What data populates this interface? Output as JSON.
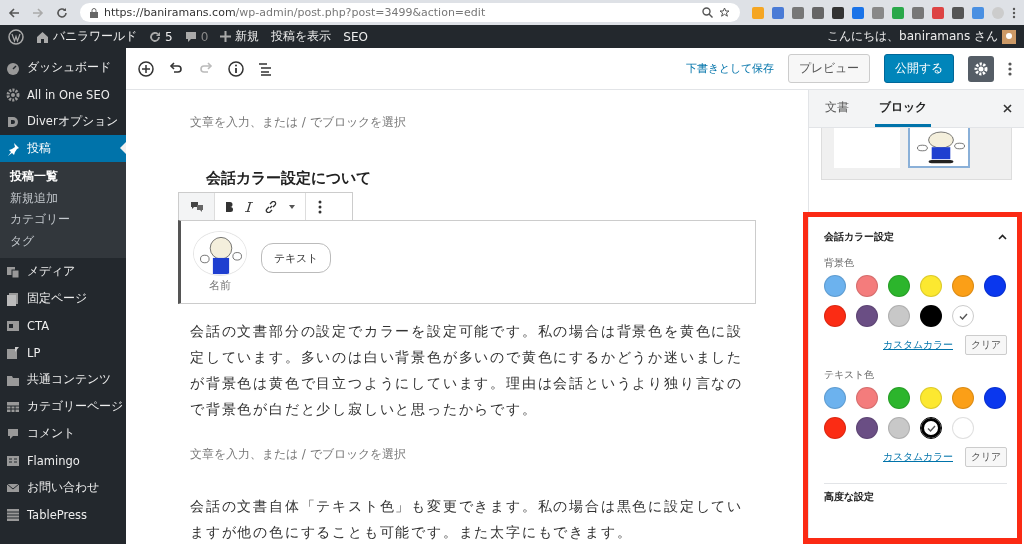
{
  "browser": {
    "url_host": "https://baniramans.com",
    "url_path": "/wp-admin/post.php?post=3499&action=edit"
  },
  "admin_bar": {
    "site": "バニラワールド",
    "updates": "5",
    "comments": "0",
    "new": "新規",
    "view": "投稿を表示",
    "seo": "SEO",
    "greeting": "こんにちは、baniramans さん"
  },
  "sidebar": {
    "items": [
      {
        "label": "ダッシュボード",
        "selected": false
      },
      {
        "label": "All in One SEO",
        "selected": false
      },
      {
        "label": "Diverオプション",
        "selected": false
      },
      {
        "label": "投稿",
        "selected": true,
        "children": [
          {
            "label": "投稿一覧",
            "selected": true
          },
          {
            "label": "新規追加",
            "selected": false
          },
          {
            "label": "カテゴリー",
            "selected": false
          },
          {
            "label": "タグ",
            "selected": false
          }
        ]
      },
      {
        "label": "メディア",
        "selected": false
      },
      {
        "label": "固定ページ",
        "selected": false
      },
      {
        "label": "CTA",
        "selected": false
      },
      {
        "label": "LP",
        "selected": false
      },
      {
        "label": "共通コンテンツ",
        "selected": false
      },
      {
        "label": "カテゴリーページ",
        "selected": false
      },
      {
        "label": "コメント",
        "selected": false
      },
      {
        "label": "Flamingo",
        "selected": false
      },
      {
        "label": "お問い合わせ",
        "selected": false
      },
      {
        "label": "TablePress",
        "selected": false
      }
    ]
  },
  "toolbar": {
    "save_draft": "下書きとして保存",
    "preview": "プレビュー",
    "publish": "公開する"
  },
  "editor": {
    "blocks": [
      {
        "kind": "placeholder",
        "text": "文章を入力、または / でブロックを選択"
      },
      {
        "kind": "heading",
        "text": "会話カラー設定について"
      },
      {
        "kind": "dialog",
        "bubble": "テキスト",
        "name": "名前"
      },
      {
        "kind": "paragraph",
        "text": "会話の文書部分の設定でカラーを設定可能です。私の場合は背景色を黄色に設定しています。多いのは白い背景色が多いので黄色にするかどうか迷いましたが背景色は黄色で目立つようにしています。理由は会話というより独り言なので背景色が白だと少し寂しいと思ったからです。"
      },
      {
        "kind": "placeholder",
        "text": "文章を入力、または / でブロックを選択"
      },
      {
        "kind": "paragraph",
        "text": "会話の文書自体「テキスト色」も変更できます。私の場合は黒色に設定していますが他の色にすることも可能です。また太字にもできます。"
      }
    ]
  },
  "settings_panel": {
    "tabs": [
      {
        "label": "文書",
        "selected": false
      },
      {
        "label": "ブロック",
        "selected": true
      }
    ],
    "section_title": "会話カラー設定",
    "expanded": true,
    "palettes": [
      {
        "label": "背景色",
        "custom": "カスタムカラー",
        "clear": "クリア",
        "swatches": [
          {
            "color": "#6cb2ee",
            "selected": false
          },
          {
            "color": "#f47c7c",
            "selected": false
          },
          {
            "color": "#2cb52c",
            "selected": false
          },
          {
            "color": "#fce830",
            "selected": false
          },
          {
            "color": "#fb9f17",
            "selected": false
          },
          {
            "color": "#0a37ee",
            "selected": false
          },
          {
            "color": "#fb2c14",
            "selected": false
          },
          {
            "color": "#6a4e84",
            "selected": false
          },
          {
            "color": "#c8c8c8",
            "selected": false
          },
          {
            "color": "#000000",
            "selected": false
          },
          {
            "color": "#ffffff",
            "selected": true
          }
        ]
      },
      {
        "label": "テキスト色",
        "custom": "カスタムカラー",
        "clear": "クリア",
        "swatches": [
          {
            "color": "#6cb2ee",
            "selected": false
          },
          {
            "color": "#f47c7c",
            "selected": false
          },
          {
            "color": "#2cb52c",
            "selected": false
          },
          {
            "color": "#fce830",
            "selected": false
          },
          {
            "color": "#fb9f17",
            "selected": false
          },
          {
            "color": "#0a37ee",
            "selected": false
          },
          {
            "color": "#fb2c14",
            "selected": false
          },
          {
            "color": "#6a4e84",
            "selected": false
          },
          {
            "color": "#c8c8c8",
            "selected": false
          },
          {
            "color": "#000000",
            "selected": true
          },
          {
            "color": "#ffffff",
            "selected": false
          }
        ]
      }
    ],
    "next_section": "高度な設定"
  }
}
